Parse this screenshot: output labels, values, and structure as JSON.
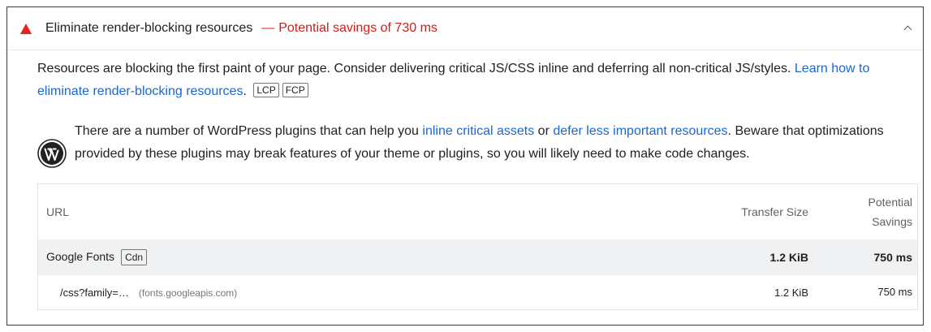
{
  "audit": {
    "title": "Eliminate render-blocking resources",
    "dash": "—",
    "savings": "Potential savings of 730 ms",
    "icon": "warning-triangle-icon",
    "status_color": "#e7241b"
  },
  "description": {
    "text": "Resources are blocking the first paint of your page. Consider delivering critical JS/CSS inline and deferring all non-critical JS/styles. ",
    "link": "Learn how to eliminate render-blocking resources",
    "period": ".",
    "chips": [
      "LCP",
      "FCP"
    ]
  },
  "wordpress": {
    "icon": "wordpress-icon",
    "text_1": "There are a number of WordPress plugins that can help you ",
    "link_1": "inline critical assets",
    "text_2": " or ",
    "link_2": "defer less important resources",
    "text_3": ". Beware that optimizations provided by these plugins may break features of your theme or plugins, so you will likely need to make code changes."
  },
  "table": {
    "headers": {
      "url": "URL",
      "size": "Transfer Size",
      "savings_1": "Potential",
      "savings_2": "Savings"
    },
    "entity": {
      "name": "Google Fonts",
      "badge": "Cdn",
      "size": "1.2 KiB",
      "savings": "750 ms"
    },
    "rows": [
      {
        "url": "/css?family=…",
        "host": "(fonts.googleapis.com)",
        "size": "1.2 KiB",
        "savings": "750 ms"
      }
    ]
  }
}
